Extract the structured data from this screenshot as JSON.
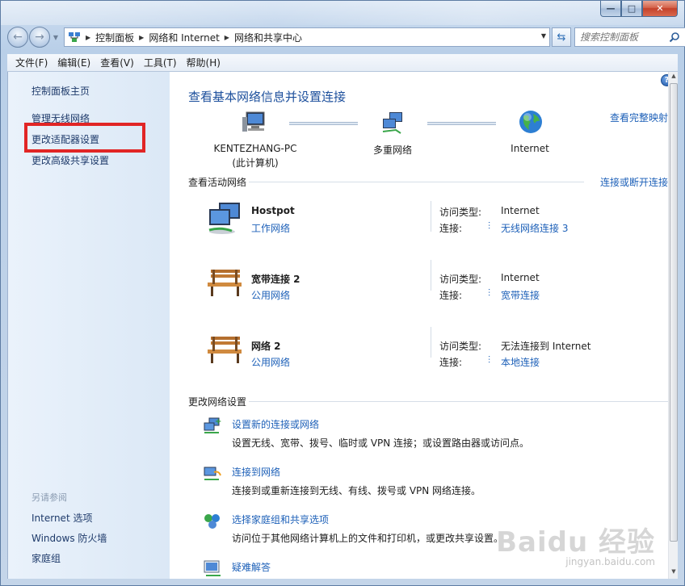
{
  "window": {
    "caption": {
      "min": "—",
      "max": "□",
      "close": "✕"
    }
  },
  "nav": {
    "back": "←",
    "forward": "→",
    "breadcrumbs": [
      "控制面板",
      "网络和 Internet",
      "网络和共享中心"
    ],
    "search_placeholder": "搜索控制面板"
  },
  "menu": [
    "文件(F)",
    "编辑(E)",
    "查看(V)",
    "工具(T)",
    "帮助(H)"
  ],
  "sidebar": {
    "home": "控制面板主页",
    "links": [
      "管理无线网络",
      "更改适配器设置",
      "更改高级共享设置"
    ],
    "see_also_label": "另请参阅",
    "see_also": [
      "Internet 选项",
      "Windows 防火墙",
      "家庭组"
    ]
  },
  "main": {
    "title": "查看基本网络信息并设置连接",
    "full_map_link": "查看完整映射",
    "map": {
      "computer_name": "KENTEZHANG-PC",
      "computer_note": "(此计算机)",
      "middle": "多重网络",
      "internet": "Internet"
    },
    "active_networks": {
      "heading": "查看活动网络",
      "link": "连接或断开连接",
      "items": [
        {
          "name": "Hostpot",
          "type": "工作网络",
          "access_label": "访问类型:",
          "access": "Internet",
          "conn_label": "连接:",
          "conn": "无线网络连接 3"
        },
        {
          "name": "宽带连接  2",
          "type": "公用网络",
          "access_label": "访问类型:",
          "access": "Internet",
          "conn_label": "连接:",
          "conn": "宽带连接"
        },
        {
          "name": "网络  2",
          "type": "公用网络",
          "access_label": "访问类型:",
          "access": "无法连接到 Internet",
          "conn_label": "连接:",
          "conn": "本地连接"
        }
      ]
    },
    "change_settings": {
      "heading": "更改网络设置",
      "tasks": [
        {
          "link": "设置新的连接或网络",
          "desc": "设置无线、宽带、拨号、临时或 VPN 连接；或设置路由器或访问点。"
        },
        {
          "link": "连接到网络",
          "desc": "连接到或重新连接到无线、有线、拨号或 VPN 网络连接。"
        },
        {
          "link": "选择家庭组和共享选项",
          "desc": "访问位于其他网络计算机上的文件和打印机，或更改共享设置。"
        },
        {
          "link": "疑难解答",
          "desc": ""
        }
      ]
    }
  },
  "watermark": {
    "main": "Baidu 经验",
    "sub": "jingyan.baidu.com"
  },
  "colors": {
    "link": "#1d60b8",
    "title": "#1c4f9c",
    "highlight": "#e12525"
  }
}
